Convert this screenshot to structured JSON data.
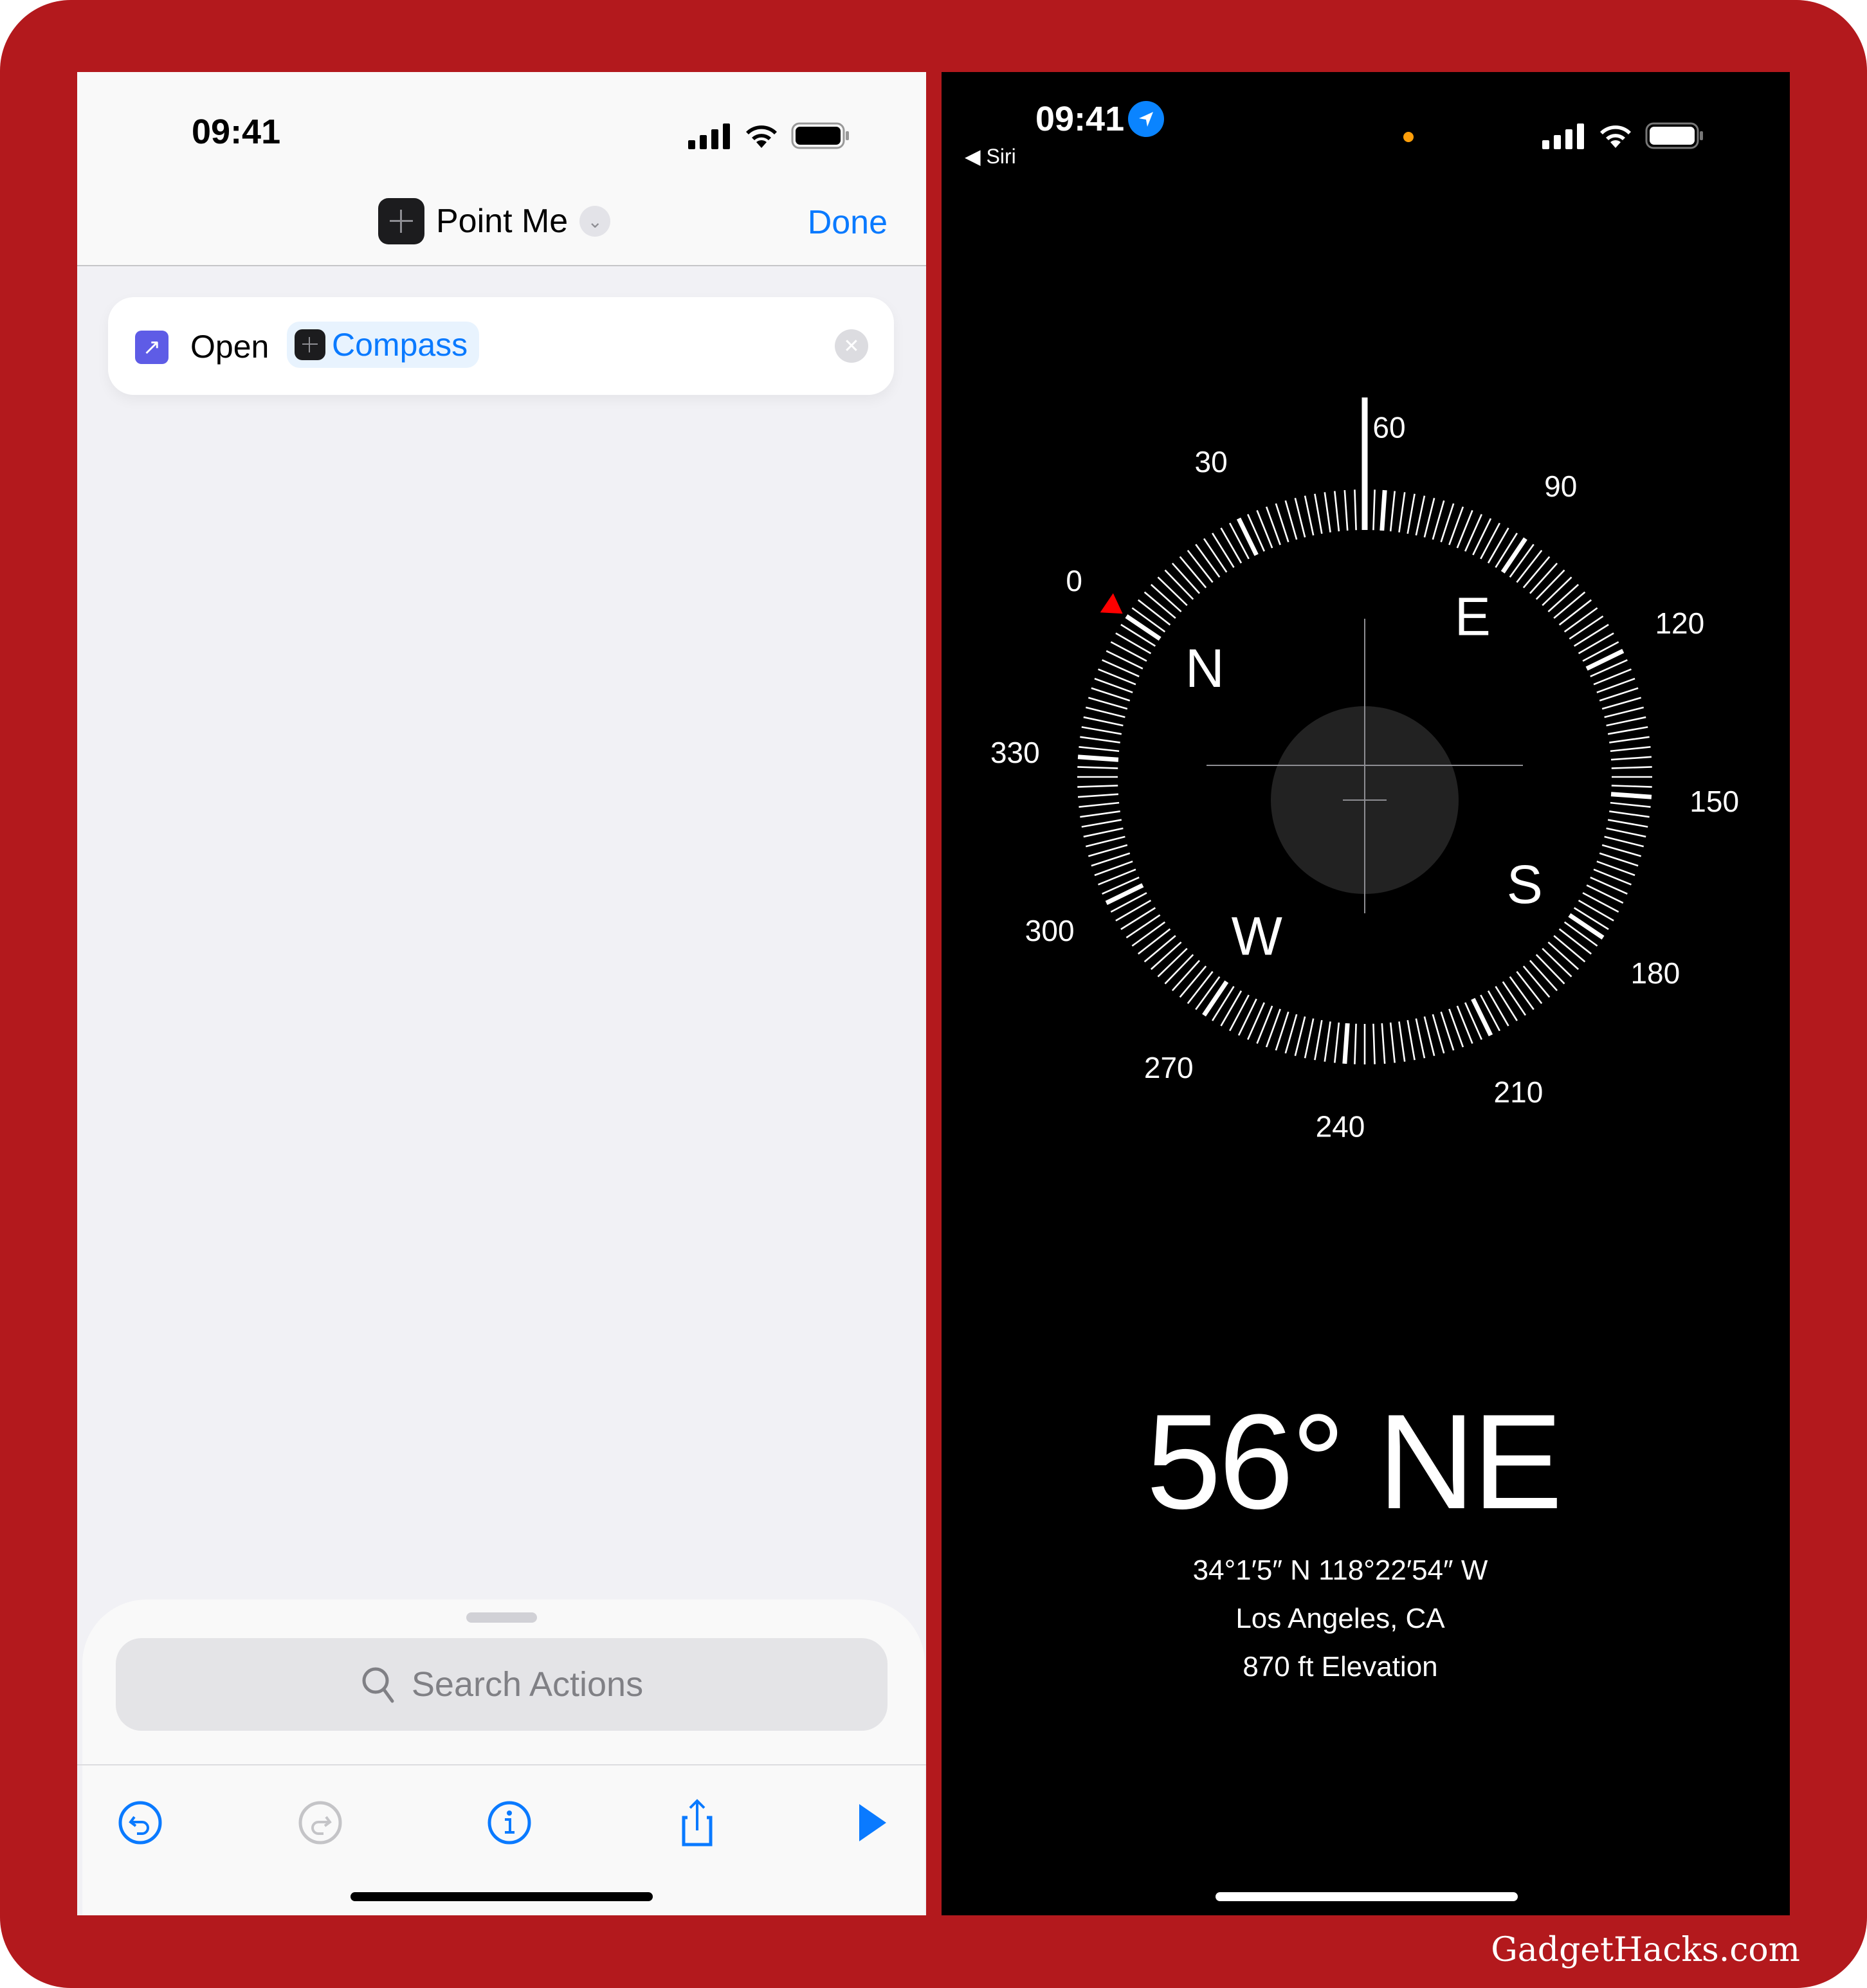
{
  "frame": {
    "background_color": "#b3191d",
    "watermark": "GadgetHacks.com"
  },
  "shortcuts": {
    "status_bar": {
      "time": "09:41",
      "icons": [
        "cellular-signal-icon",
        "wifi-icon",
        "battery-icon"
      ]
    },
    "header": {
      "shortcut_name": "Point Me",
      "done_label": "Done",
      "accent": "#0a7aff"
    },
    "action": {
      "verb": "Open",
      "app_name": "Compass"
    },
    "search": {
      "placeholder": "Search Actions"
    },
    "toolbar": {
      "buttons": [
        "undo",
        "redo",
        "info",
        "share",
        "run"
      ]
    }
  },
  "compass": {
    "status_bar": {
      "time": "09:41",
      "back_label": "◀ Siri",
      "icons": [
        "cellular-signal-icon",
        "wifi-icon",
        "battery-icon"
      ]
    },
    "heading_degrees": 56,
    "heading_label": "56° NE",
    "coordinates": "34°1′5″ N  118°22′54″ W",
    "location": "Los Angeles, CA",
    "elevation": "870 ft Elevation",
    "cardinals": [
      "N",
      "E",
      "S",
      "W"
    ],
    "degree_labels": [
      "0",
      "30",
      "60",
      "90",
      "120",
      "150",
      "180",
      "210",
      "240",
      "270",
      "300",
      "330"
    ],
    "north_marker_color": "#ff0000"
  }
}
